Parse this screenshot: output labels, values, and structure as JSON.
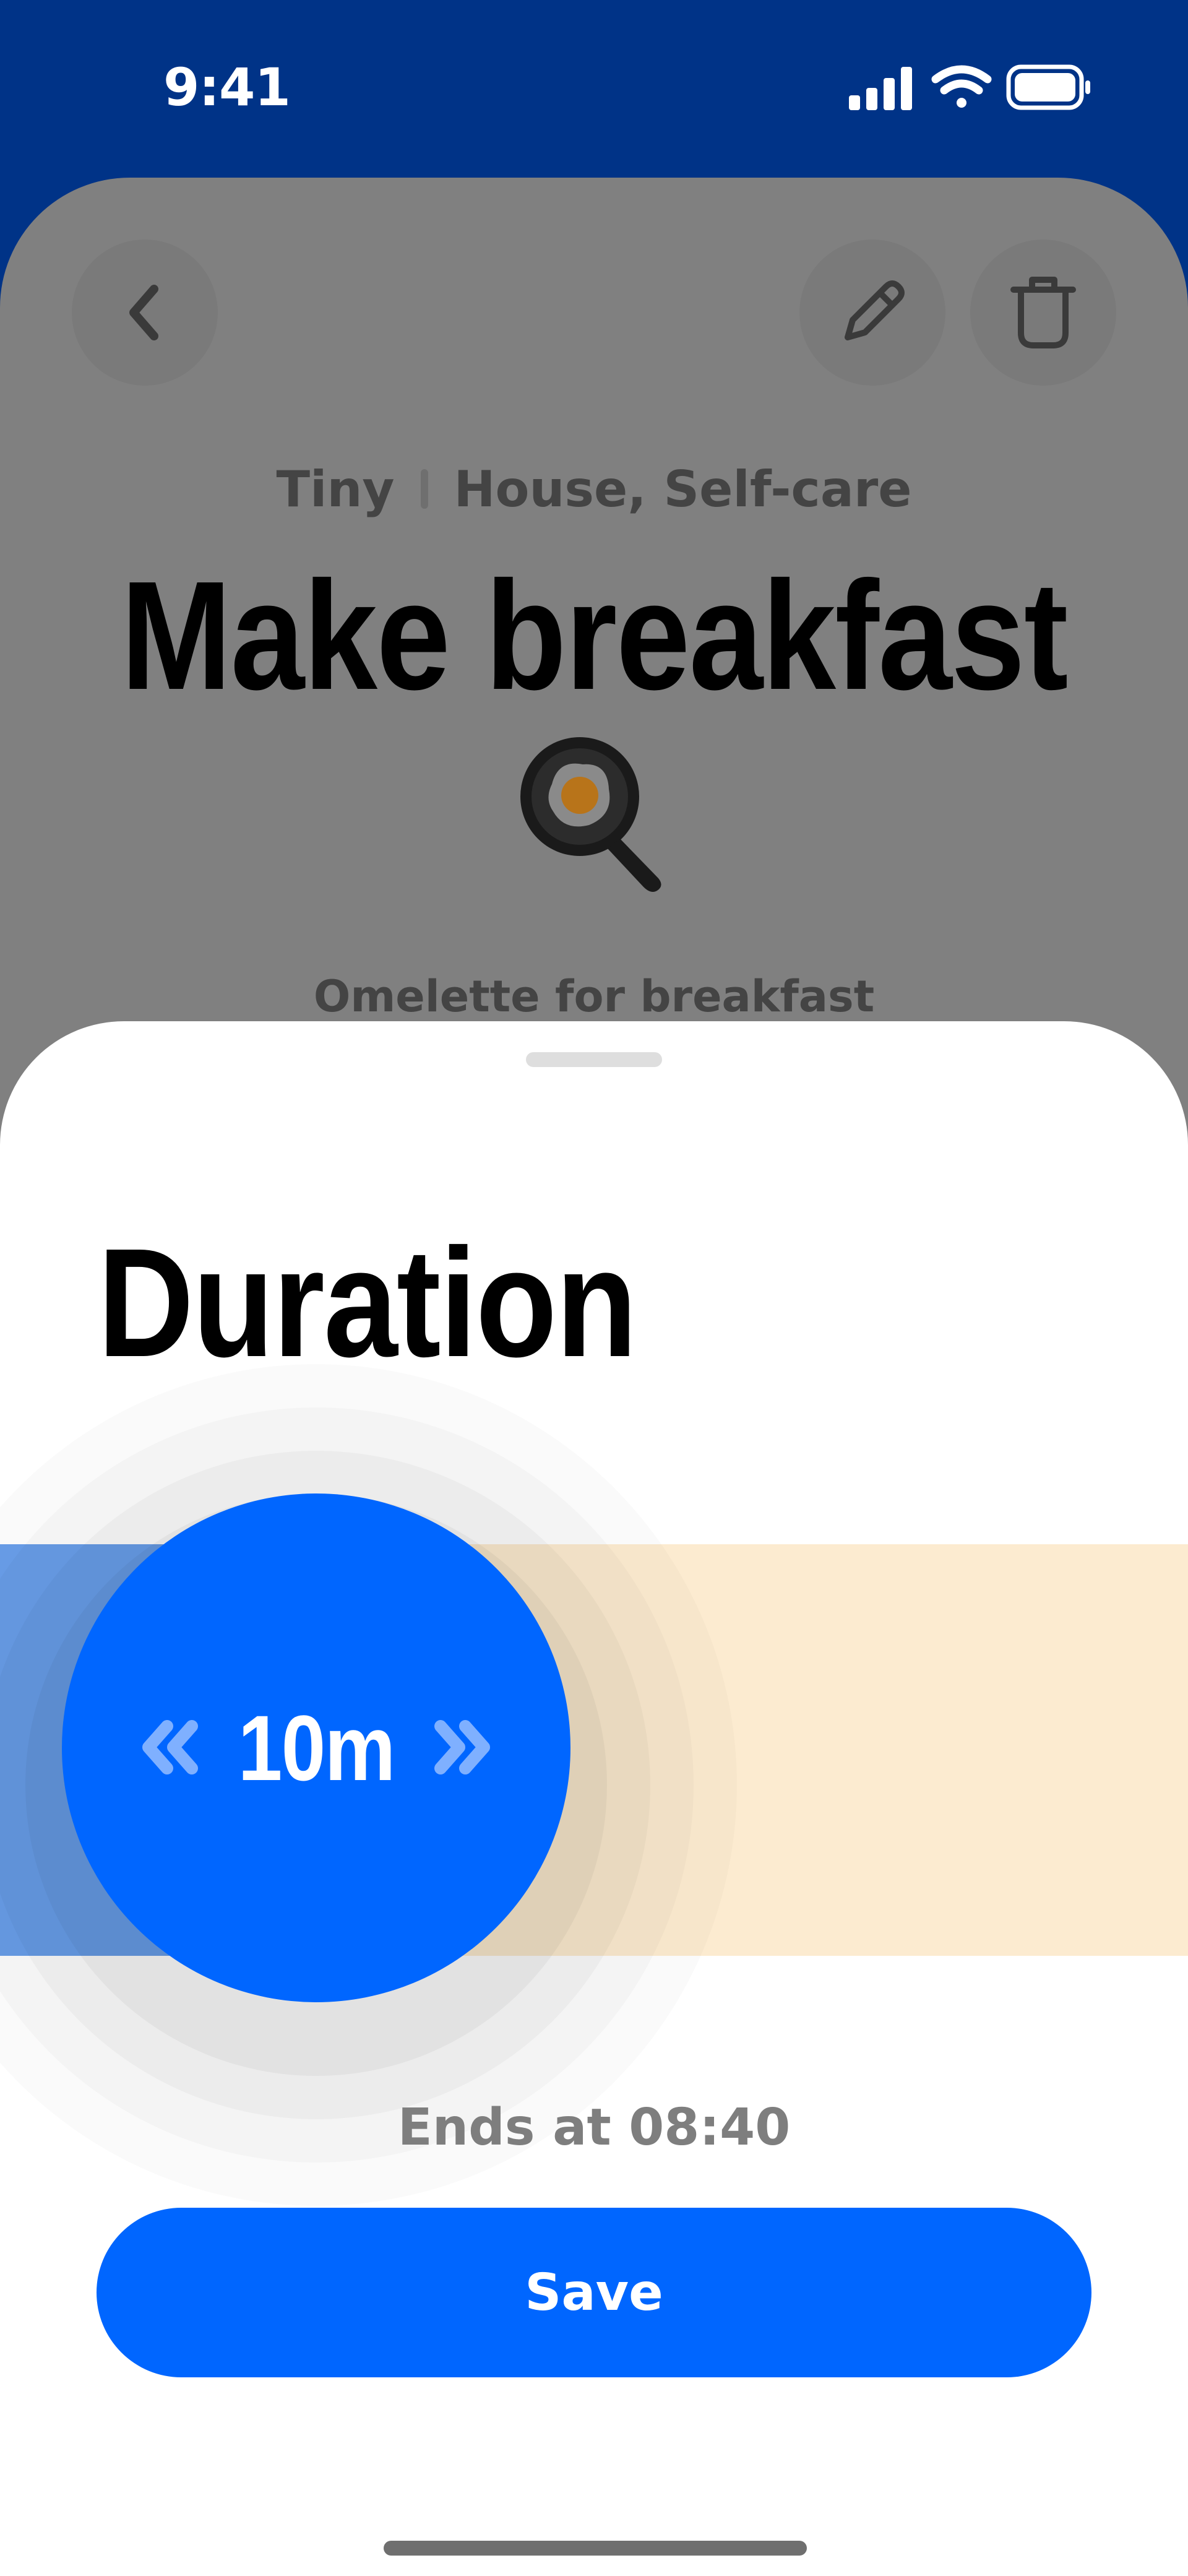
{
  "status_bar": {
    "time": "9:41",
    "icons": [
      "signal-icon",
      "wifi-icon",
      "battery-icon"
    ]
  },
  "task": {
    "size": "Tiny",
    "categories": "House, Self-care",
    "title": "Make breakfast",
    "emoji": "frying-pan-egg-icon",
    "note": "Omelette for breakfast",
    "actions": [
      "back-icon",
      "pencil-icon",
      "trash-icon"
    ]
  },
  "duration_sheet": {
    "title": "Duration",
    "value_label": "10m",
    "slider_fraction": 0.27,
    "ends_at": "Ends at 08:40",
    "save_label": "Save"
  },
  "colors": {
    "header_blue": "#003387",
    "accent_blue": "#0066ff",
    "track_filled": "#6a9fea",
    "track_remaining": "#fcebd0",
    "overlay_gray": "#808080"
  }
}
